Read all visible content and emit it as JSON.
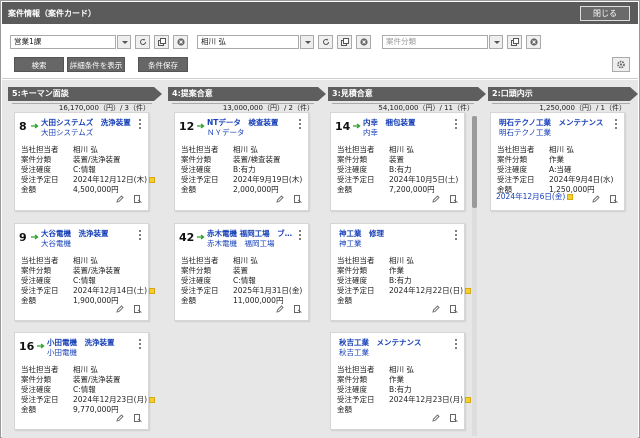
{
  "window": {
    "title": "案件情報（案件カード）",
    "close_label": "閉じる"
  },
  "filter": {
    "dept": "営業1課",
    "person": "相川 弘",
    "category_placeholder": "案件分類",
    "search_label": "検索",
    "detail_label": "詳細条件を表示",
    "save_label": "条件保存"
  },
  "columns": [
    {
      "title": "5:キーマン面談",
      "summary": "16,170,000（円）/ 3（件）"
    },
    {
      "title": "4:提案合意",
      "summary": "13,000,000（円）/ 2（件）"
    },
    {
      "title": "3:見積合意",
      "summary": "54,100,000（円）/ 11（件）"
    },
    {
      "title": "2:口頭内示",
      "summary": "1,250,000（円）/ 1（件）"
    }
  ],
  "labels": {
    "owner": "当社担当者",
    "category": "案件分類",
    "certainty": "受注確度",
    "date": "受注予定日",
    "amount": "金額"
  },
  "cards": [
    {
      "num": "8",
      "title": "大田システムズ　洗浄装置",
      "company": "大田システムズ",
      "owner": "相川 弘",
      "category": "装置/洗浄装置",
      "certainty": "C:情報",
      "date": "2024年12月12日(木)",
      "amount": "4,500,000円"
    },
    {
      "num": "9",
      "title": "大谷電機　洗浄装置",
      "company": "大谷電機",
      "owner": "相川 弘",
      "category": "装置/洗浄装置",
      "certainty": "C:情報",
      "date": "2024年12月14日(土)",
      "amount": "1,900,000円"
    },
    {
      "num": "16",
      "title": "小田電機　洗浄装置",
      "company": "小田電機",
      "owner": "相川 弘",
      "category": "装置/洗浄装置",
      "certainty": "C:情報",
      "date": "2024年12月23日(月)",
      "amount": "9,770,000円"
    },
    {
      "num": "12",
      "title": "NTデータ　検査装置",
      "company": "ＮＹデータ",
      "owner": "相川 弘",
      "category": "装置/検査装置",
      "certainty": "B:有力",
      "date": "2024年9月19日(木)",
      "amount": "2,000,000円"
    },
    {
      "num": "42",
      "title": "赤木電機 福岡工場　ブ…",
      "company": "赤木電機　福岡工場",
      "owner": "相川 弘",
      "category": "装置",
      "certainty": "C:情報",
      "date": "2025年1月31日(金)",
      "amount": "11,000,000円"
    },
    {
      "num": "14",
      "title": "内幸　梱包装置",
      "company": "内幸",
      "owner": "相川 弘",
      "category": "装置",
      "certainty": "B:有力",
      "date": "2024年10月5日(土)",
      "amount": "7,200,000円"
    },
    {
      "num": "",
      "title": "神工業　修理",
      "company": "神工業",
      "owner": "相川 弘",
      "category": "作業",
      "certainty": "B:有力",
      "date": "2024年12月22日(日)",
      "amount": ""
    },
    {
      "num": "",
      "title": "秋吉工業　メンテナンス",
      "company": "秋吉工業",
      "owner": "相川 弘",
      "category": "作業",
      "certainty": "B:有力",
      "date": "2024年12月23日(月)",
      "amount": ""
    },
    {
      "num": "",
      "title": "明石テクノ工業　メンテナンス",
      "company": "明石テクノ工業",
      "owner": "相川 弘",
      "category": "作業",
      "certainty": "A:当確",
      "date": "2024年9月4日(水)",
      "amount": "1,250,000円",
      "extra_date": "2024年12月6日(金)"
    }
  ],
  "colors": {
    "title_bar": "#5b5b5b",
    "link": "#1740b8",
    "arrow": "#2aa02a",
    "memo": "#f3d02e"
  }
}
